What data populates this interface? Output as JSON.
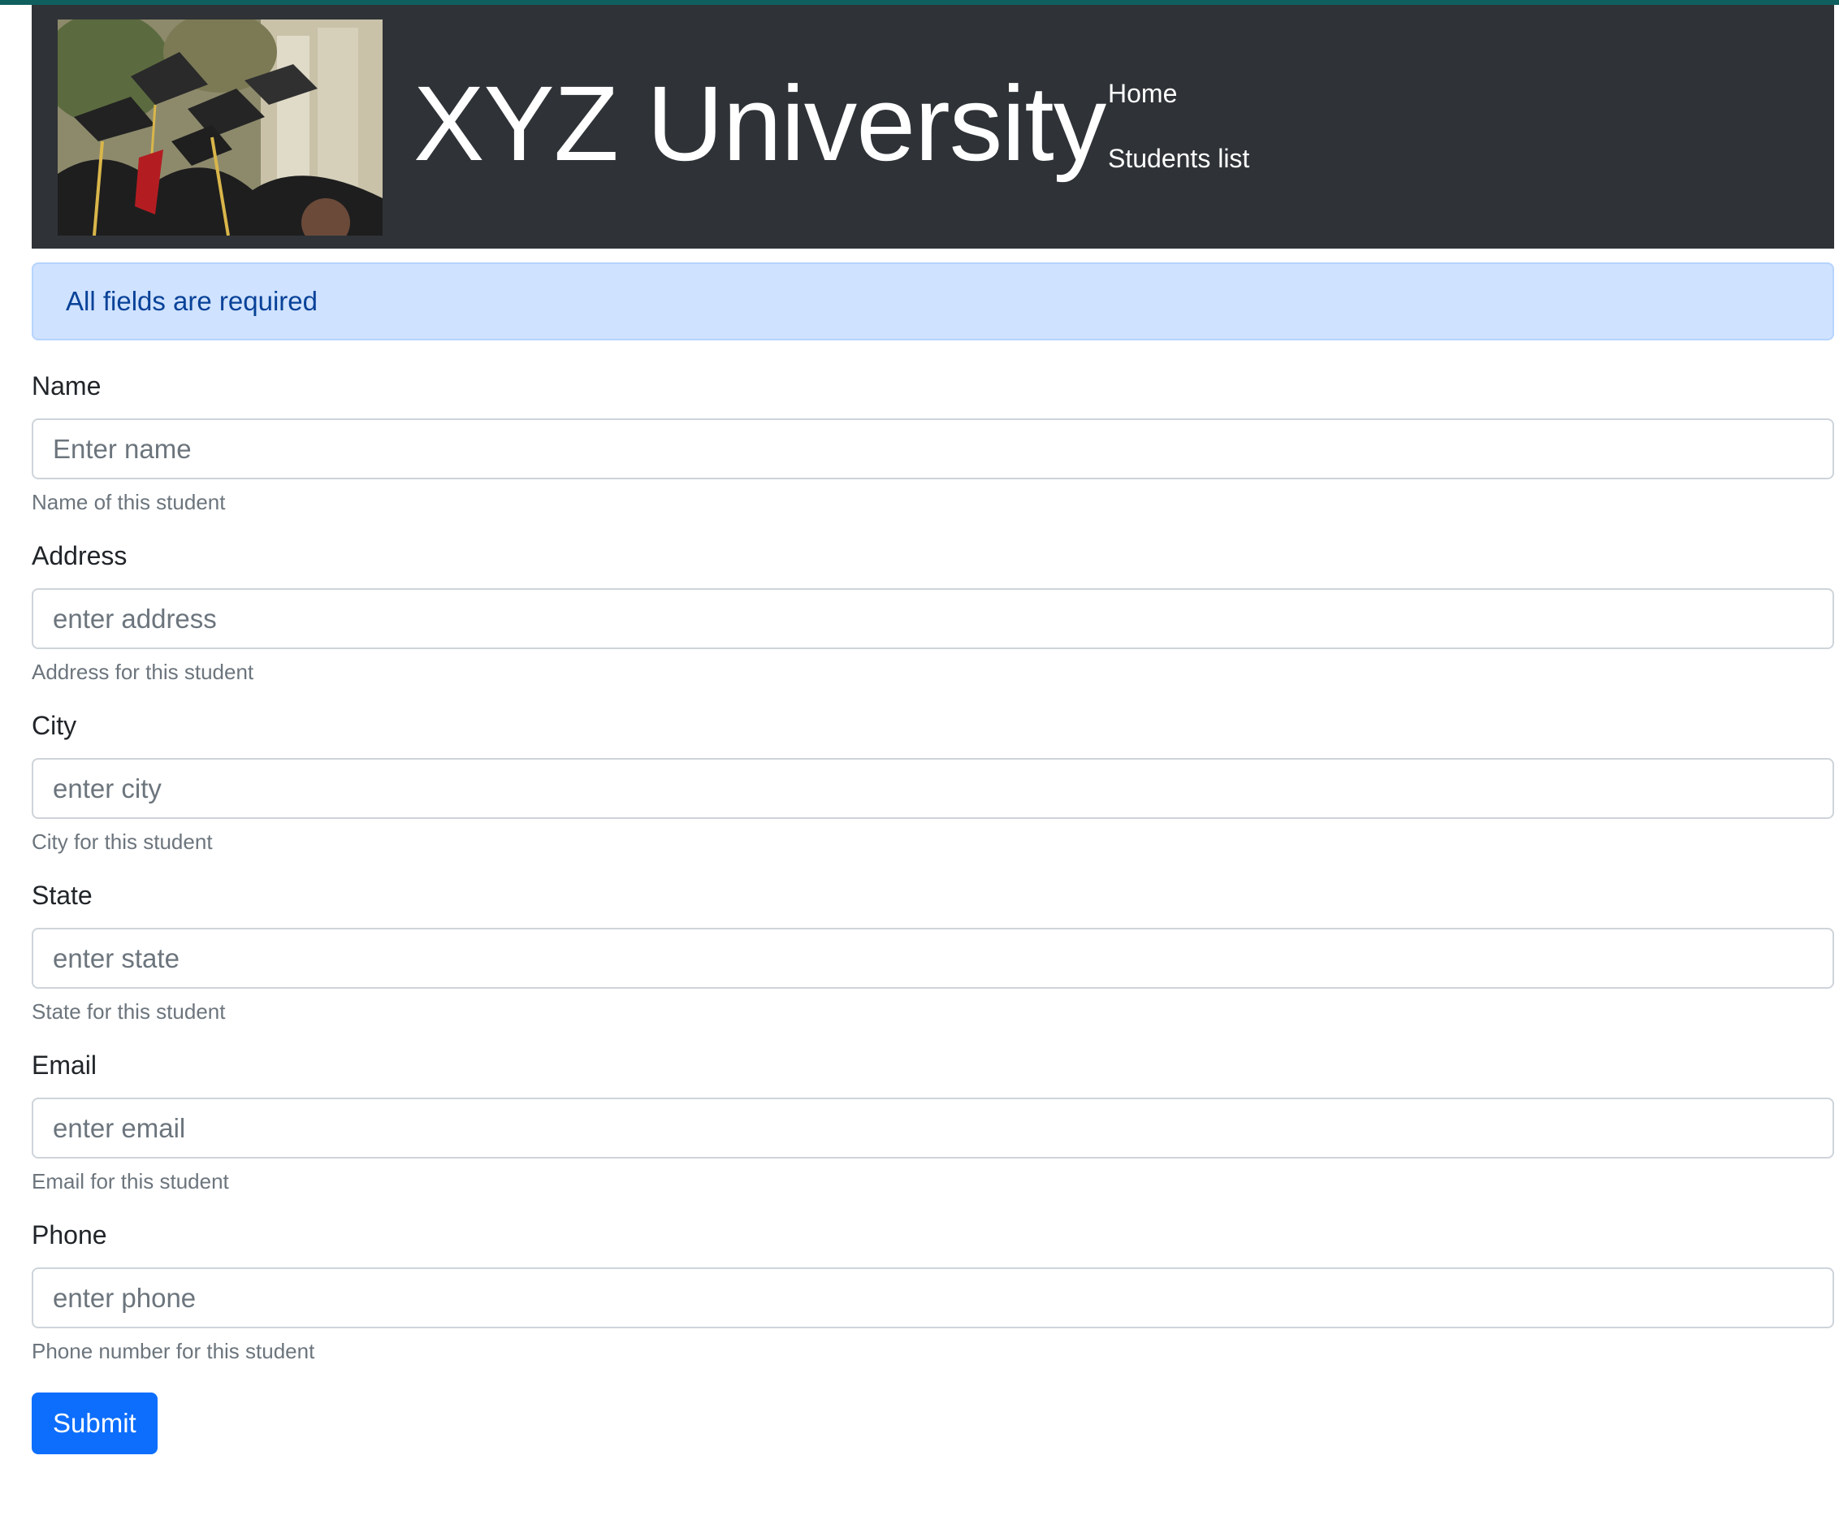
{
  "header": {
    "brand": "XYZ University",
    "banner_image": "graduation-caps-photo",
    "nav": [
      {
        "label": "Home"
      },
      {
        "label": "Students list"
      }
    ],
    "background_color": "#2f3337"
  },
  "alert": {
    "text": "All fields are required",
    "color": "#cfe2ff"
  },
  "form": {
    "fields": [
      {
        "label": "Name",
        "placeholder": "Enter name",
        "help": "Name of this student"
      },
      {
        "label": "Address",
        "placeholder": "enter address",
        "help": "Address for this student"
      },
      {
        "label": "City",
        "placeholder": "enter city",
        "help": "City for this student"
      },
      {
        "label": "State",
        "placeholder": "enter state",
        "help": "State for this student"
      },
      {
        "label": "Email",
        "placeholder": "enter email",
        "help": "Email for this student"
      },
      {
        "label": "Phone",
        "placeholder": "enter phone",
        "help": "Phone number for this student"
      }
    ],
    "submit_label": "Submit",
    "submit_color": "#0d6efd"
  }
}
